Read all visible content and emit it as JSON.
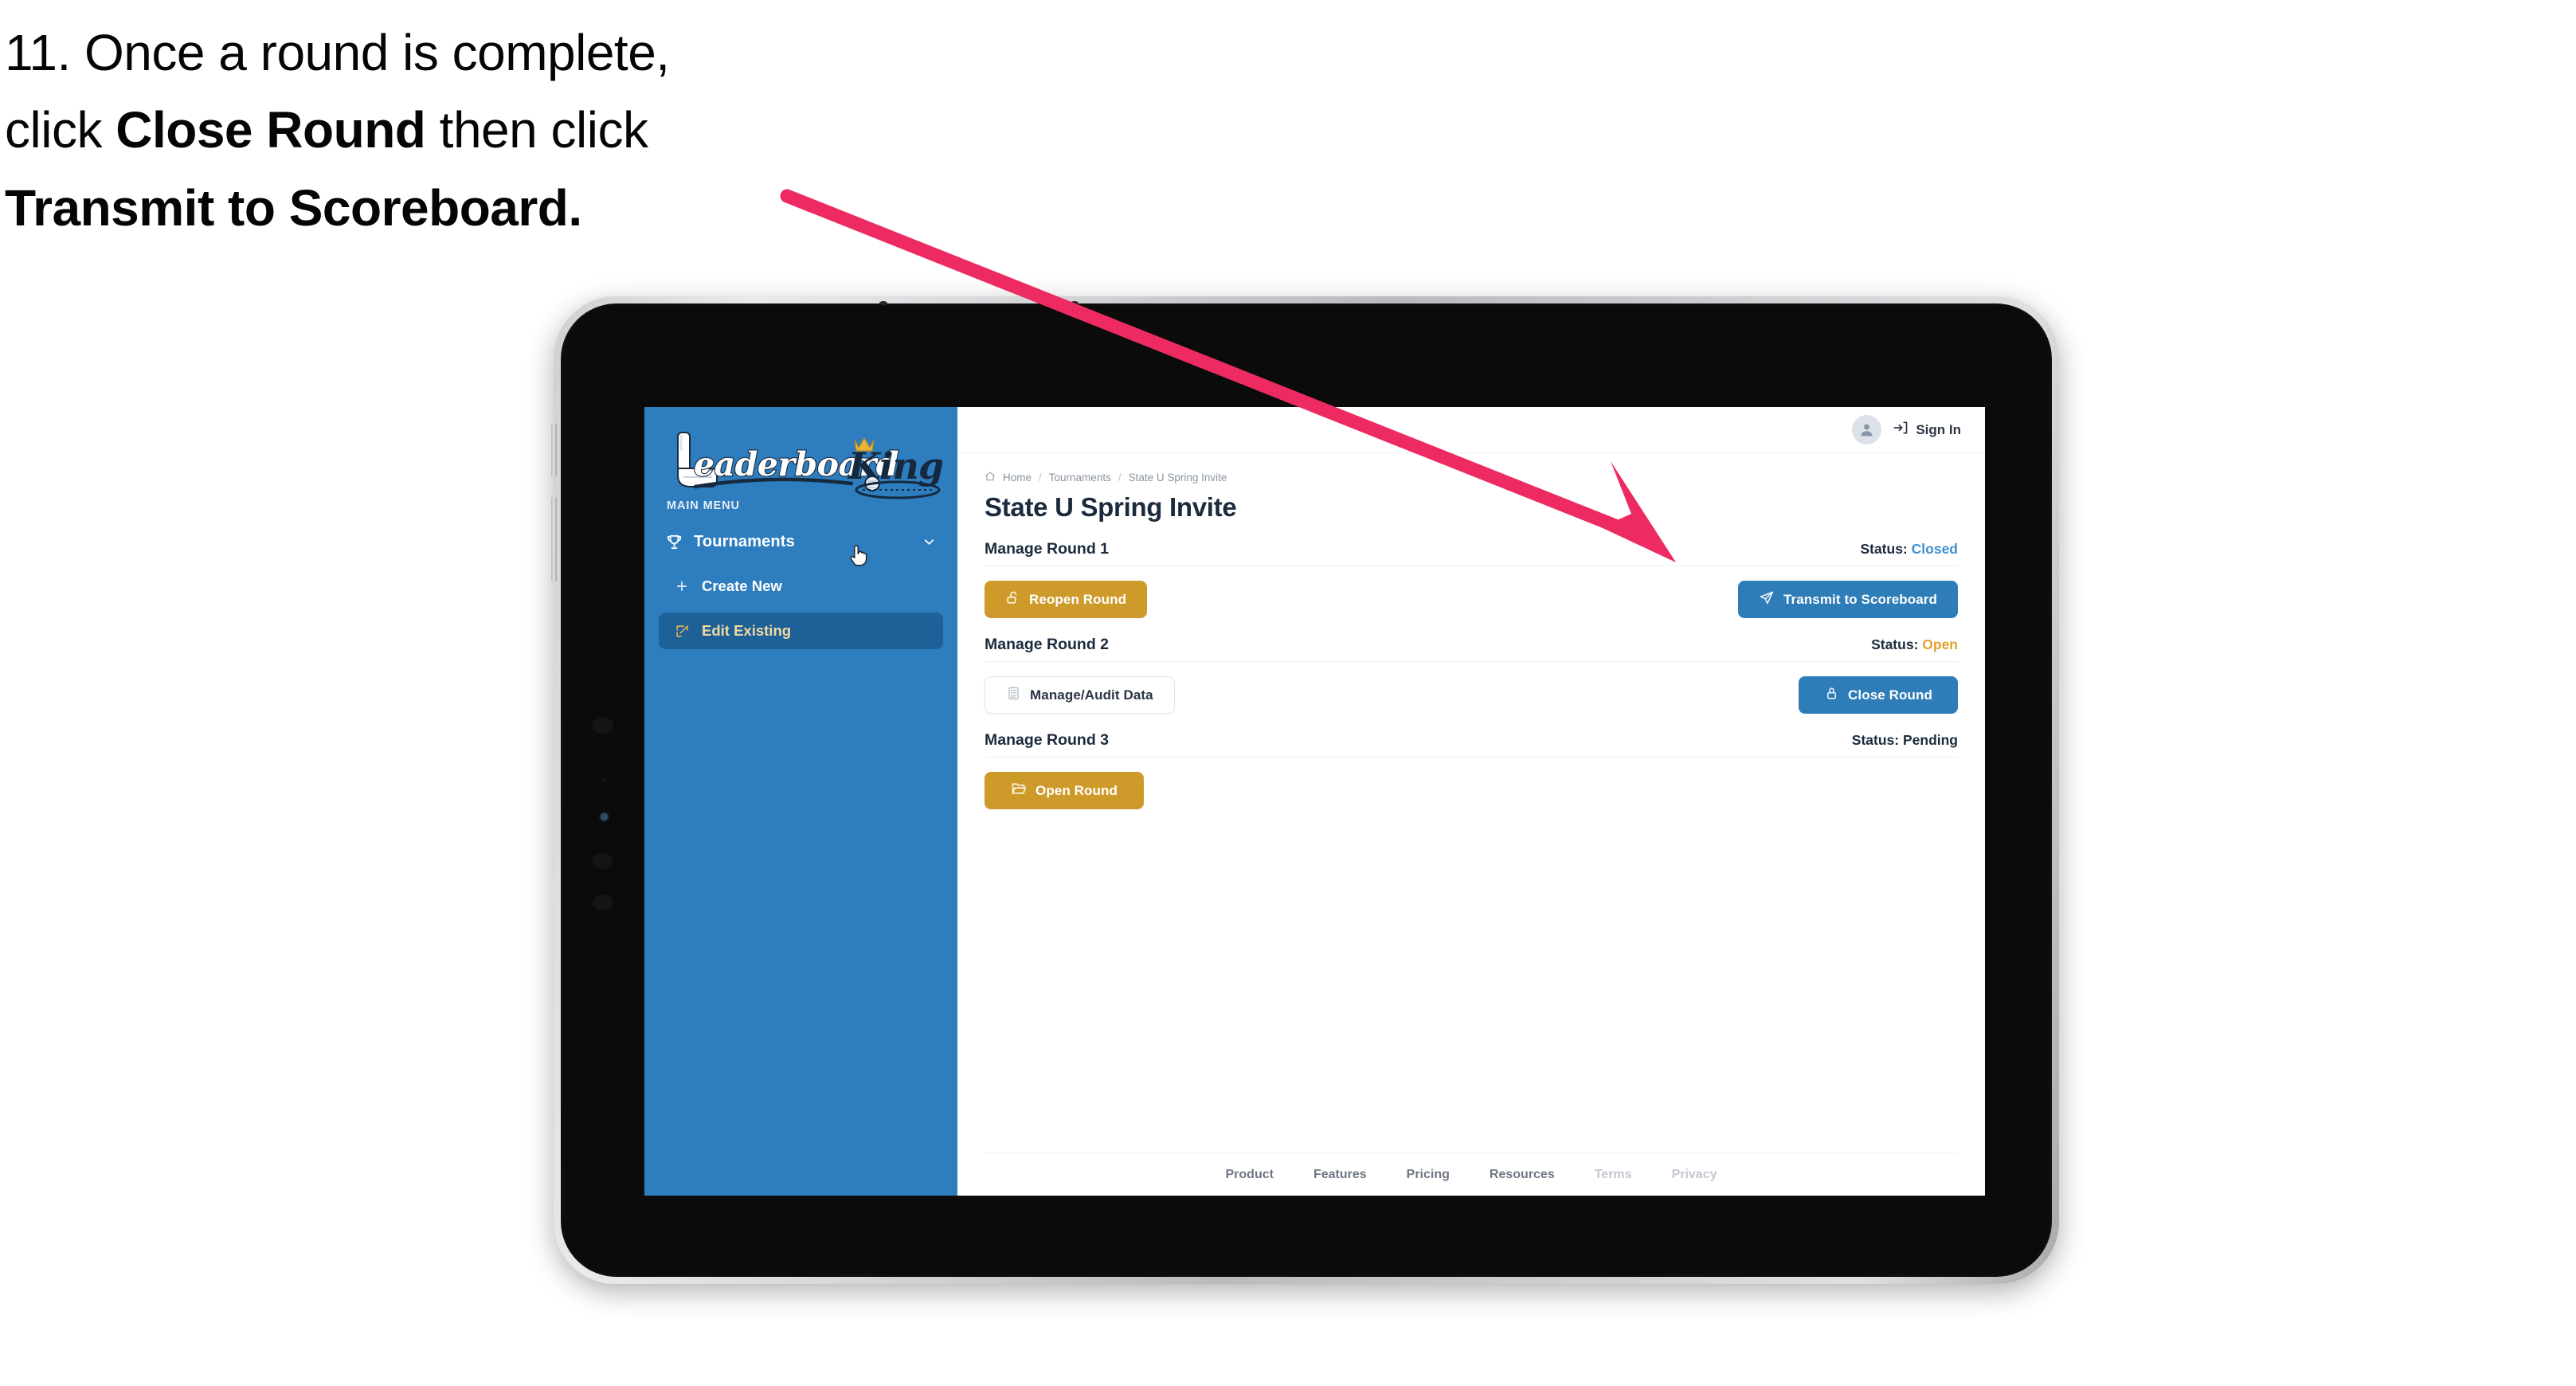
{
  "caption": {
    "line1_plain": "11. Once a round is complete,",
    "line2_pre": "click ",
    "line2_bold": "Close Round",
    "line2_post": " then click",
    "line3_bold": "Transmit to Scoreboard."
  },
  "annotation": {
    "arrow_color": "#ED2A62",
    "points_to": "Transmit to Scoreboard"
  },
  "app": {
    "sidebar": {
      "logo_text_primary": "Leaderboard",
      "logo_text_secondary": "King",
      "section_label": "MAIN MENU",
      "nav": [
        {
          "label": "Tournaments",
          "icon": "trophy-icon",
          "chevron": "chevron-down-icon"
        }
      ],
      "sub_items": [
        {
          "label": "Create New",
          "icon": "plus-icon",
          "active": false
        },
        {
          "label": "Edit Existing",
          "icon": "edit-square-icon",
          "active": true
        }
      ],
      "bg_color": "#2E7DBE",
      "active_bg_color": "#1E6199",
      "active_text_color": "#F2D9A0"
    },
    "topbar": {
      "avatar_icon": "user-avatar-icon",
      "signin_icon": "sign-in-icon",
      "signin_label": "Sign In"
    },
    "breadcrumb": {
      "home_icon": "home-icon",
      "items": [
        "Home",
        "Tournaments",
        "State U Spring Invite"
      ],
      "separator": "/"
    },
    "page_title": "State U Spring Invite",
    "rounds": [
      {
        "title": "Manage Round 1",
        "status_label": "Status:",
        "status_value": "Closed",
        "status_kind": "closed",
        "left_button": {
          "label": "Reopen Round",
          "icon": "unlock-icon",
          "style": "gold"
        },
        "right_button": {
          "label": "Transmit to Scoreboard",
          "icon": "paper-plane-icon",
          "style": "blue"
        }
      },
      {
        "title": "Manage Round 2",
        "status_label": "Status:",
        "status_value": "Open",
        "status_kind": "open",
        "left_button": {
          "label": "Manage/Audit Data",
          "icon": "calculator-icon",
          "style": "ghost"
        },
        "right_button": {
          "label": "Close Round",
          "icon": "lock-icon",
          "style": "blue"
        }
      },
      {
        "title": "Manage Round 3",
        "status_label": "Status:",
        "status_value": "Pending",
        "status_kind": "pending",
        "left_button": {
          "label": "Open Round",
          "icon": "folder-open-icon",
          "style": "gold"
        },
        "right_button": null
      }
    ],
    "footer": {
      "links": [
        {
          "label": "Product",
          "muted": false
        },
        {
          "label": "Features",
          "muted": false
        },
        {
          "label": "Pricing",
          "muted": false
        },
        {
          "label": "Resources",
          "muted": false
        },
        {
          "label": "Terms",
          "muted": true
        },
        {
          "label": "Privacy",
          "muted": true
        }
      ]
    },
    "cursor": {
      "icon": "pointer-hand-cursor"
    },
    "colors": {
      "gold": "#CE9B2B",
      "blue": "#2E7CB8",
      "sidebar_blue": "#2E7DBE",
      "status_closed": "#3E8FD0",
      "status_open": "#E0A32E",
      "text_dark": "#1b2a3d"
    }
  }
}
